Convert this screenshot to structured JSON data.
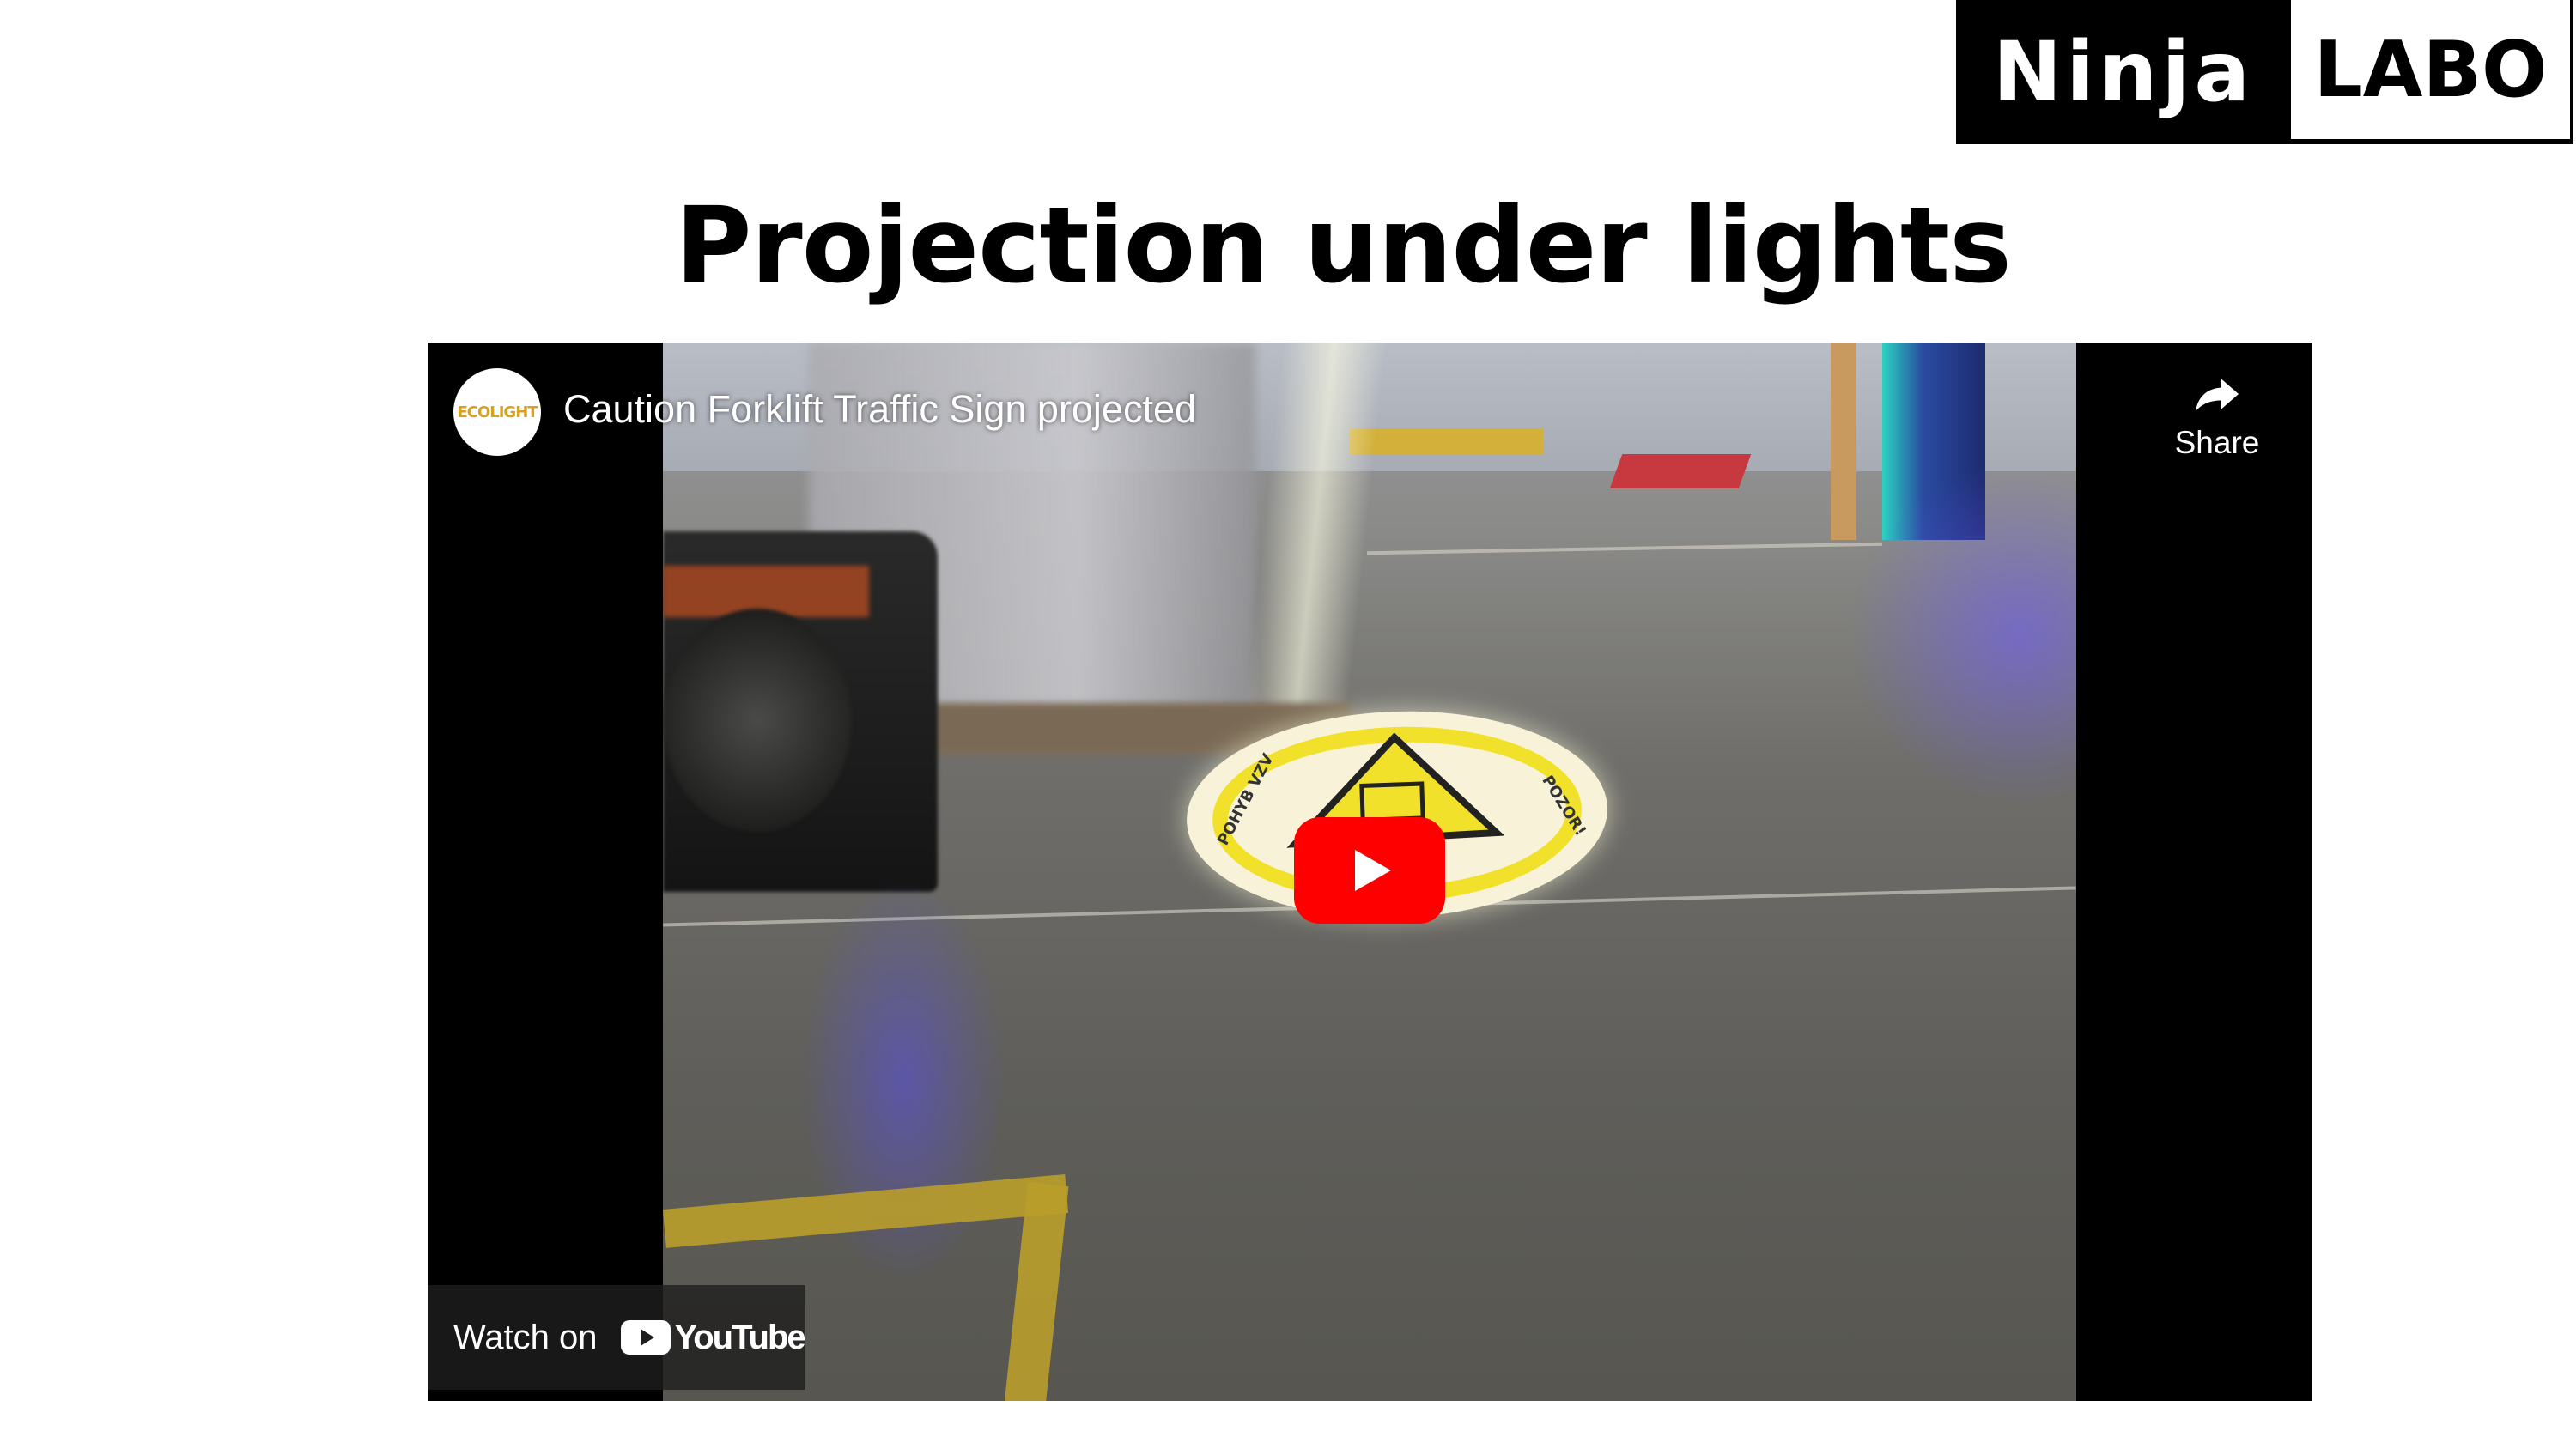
{
  "logo": {
    "ninja": "Ninja",
    "labo": "LABO"
  },
  "slide": {
    "title": "Projection under lights"
  },
  "video": {
    "channel_avatar_text": "ECOLIGHT",
    "title": "Caution Forklift Traffic Sign projected",
    "share_label": "Share",
    "watch_on_label": "Watch on",
    "youtube_wordmark": "YouTube",
    "projected_sign_text_left": "POHYB VZV",
    "projected_sign_text_right": "POZOR!"
  },
  "colors": {
    "play_button": "#ff0000",
    "background": "#ffffff",
    "logo_background": "#000000"
  },
  "icons": {
    "share": "share-arrow-icon",
    "play": "play-icon",
    "youtube": "youtube-logo-icon"
  }
}
